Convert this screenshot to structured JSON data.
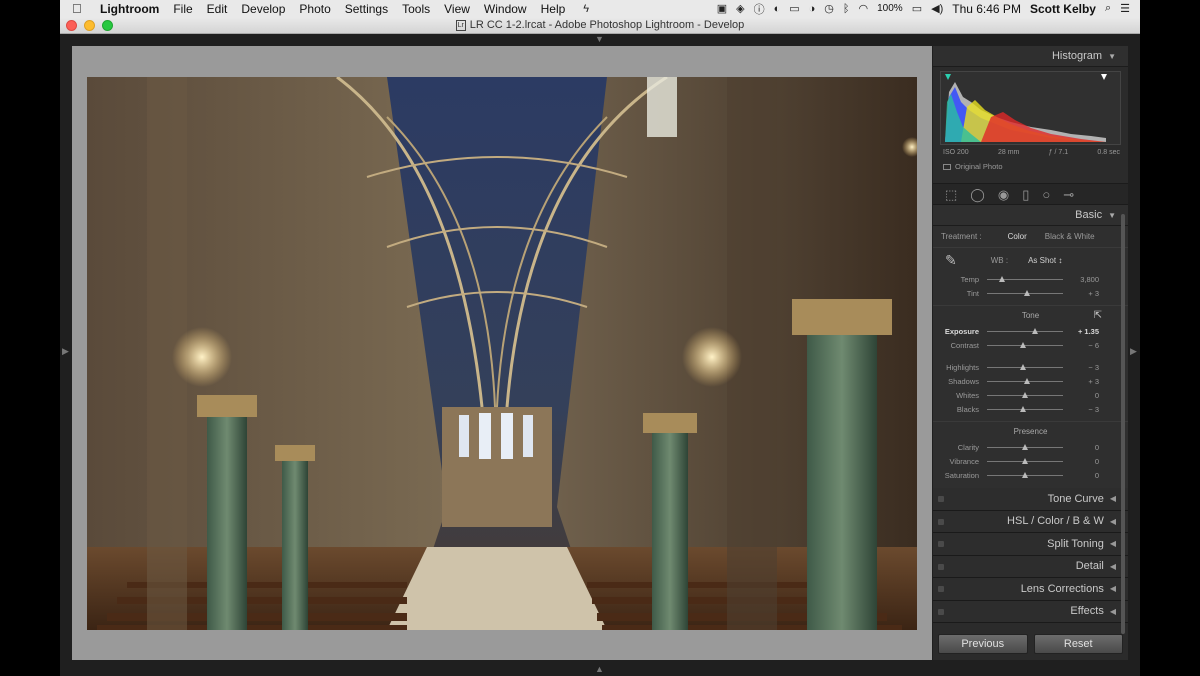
{
  "menubar": {
    "apple": "",
    "items": [
      "Lightroom",
      "File",
      "Edit",
      "Develop",
      "Photo",
      "Settings",
      "Tools",
      "View",
      "Window",
      "Help"
    ],
    "battery": "100%",
    "clock": "Thu 6:46 PM",
    "user": "Scott Kelby"
  },
  "window": {
    "title": "LR CC 1-2.lrcat - Adobe Photoshop Lightroom - Develop"
  },
  "panel": {
    "histogram": {
      "title": "Histogram",
      "iso": "ISO 200",
      "focal": "28 mm",
      "aperture": "ƒ / 7.1",
      "shutter": "0.8 sec",
      "original_photo": "Original Photo"
    },
    "basic": {
      "title": "Basic",
      "treatment_label": "Treatment :",
      "treatment_color": "Color",
      "treatment_bw": "Black & White",
      "wb_label": "WB :",
      "wb_value": "As Shot ↕",
      "rows_wb": [
        {
          "label": "Temp",
          "value": "3,800",
          "pos": 0.2
        },
        {
          "label": "Tint",
          "value": "+ 3",
          "pos": 0.52
        }
      ],
      "tone_label": "Tone",
      "tone_auto": "Auto",
      "rows_tone": [
        {
          "label": "Exposure",
          "value": "+ 1.35",
          "pos": 0.63,
          "active": true
        },
        {
          "label": "Contrast",
          "value": "− 6",
          "pos": 0.47
        }
      ],
      "rows_tone2": [
        {
          "label": "Highlights",
          "value": "− 3",
          "pos": 0.48
        },
        {
          "label": "Shadows",
          "value": "+ 3",
          "pos": 0.52
        },
        {
          "label": "Whites",
          "value": "0",
          "pos": 0.5
        },
        {
          "label": "Blacks",
          "value": "− 3",
          "pos": 0.48
        }
      ],
      "presence_label": "Presence",
      "rows_presence": [
        {
          "label": "Clarity",
          "value": "0",
          "pos": 0.5
        },
        {
          "label": "Vibrance",
          "value": "0",
          "pos": 0.5
        },
        {
          "label": "Saturation",
          "value": "0",
          "pos": 0.5
        }
      ]
    },
    "collapsed": [
      {
        "name": "tone-curve",
        "label": "Tone Curve"
      },
      {
        "name": "hsl",
        "label": "HSL  /  Color  /  B & W"
      },
      {
        "name": "split-toning",
        "label": "Split Toning"
      },
      {
        "name": "detail",
        "label": "Detail"
      },
      {
        "name": "lens-corrections",
        "label": "Lens Corrections"
      },
      {
        "name": "effects",
        "label": "Effects"
      }
    ],
    "buttons": {
      "previous": "Previous",
      "reset": "Reset"
    }
  },
  "colors": {
    "panel_bg": "#2b2b2b",
    "canvas_bg": "#9a9a9a"
  }
}
